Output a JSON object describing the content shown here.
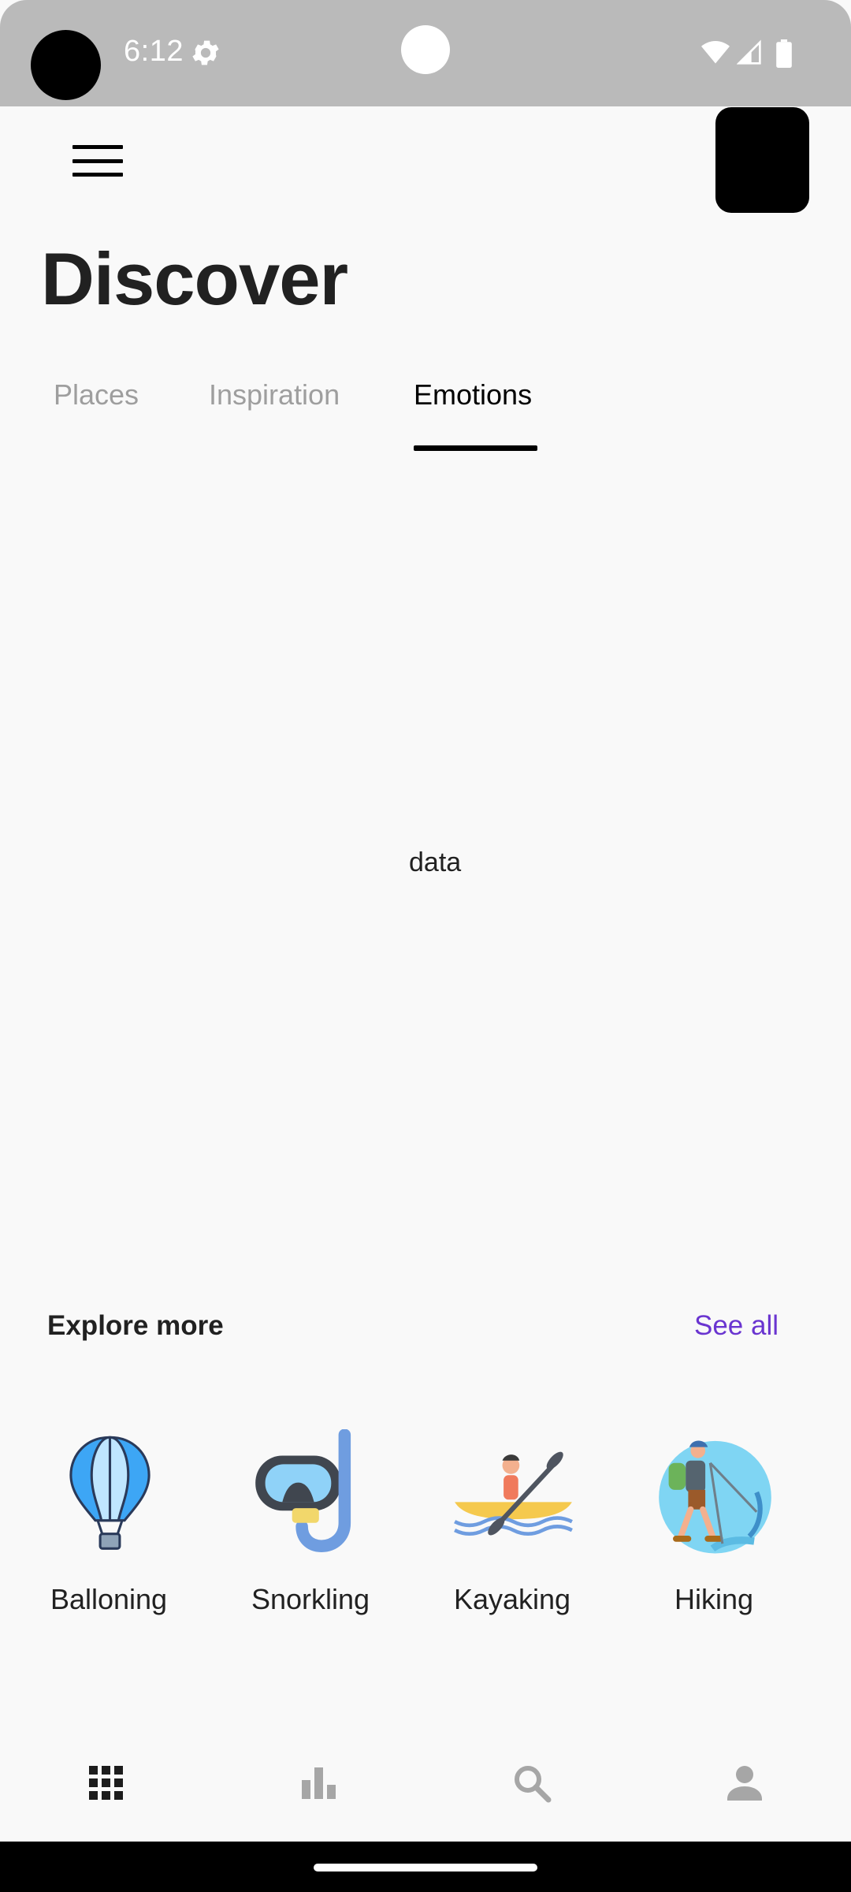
{
  "status_bar": {
    "time": "6:12",
    "icons": [
      "gear-icon",
      "wifi-icon",
      "cell-signal-icon",
      "battery-icon"
    ]
  },
  "app_bar": {
    "menu_icon": "hamburger-menu-icon",
    "avatar": "avatar"
  },
  "page": {
    "title": "Discover"
  },
  "tabs": [
    {
      "label": "Places",
      "active": false
    },
    {
      "label": "Inspiration",
      "active": false
    },
    {
      "label": "Emotions",
      "active": true
    }
  ],
  "content": {
    "placeholder_text": "data"
  },
  "explore": {
    "title": "Explore more",
    "see_all": "See all",
    "see_all_color": "#6a35d0",
    "items": [
      {
        "label": "Balloning",
        "icon": "hot-air-balloon-icon"
      },
      {
        "label": "Snorkling",
        "icon": "snorkel-mask-icon"
      },
      {
        "label": "Kayaking",
        "icon": "kayak-icon"
      },
      {
        "label": "Hiking",
        "icon": "hiker-icon"
      }
    ]
  },
  "bottom_nav": [
    {
      "icon": "grid-icon",
      "active": true
    },
    {
      "icon": "bar-chart-icon",
      "active": false
    },
    {
      "icon": "search-icon",
      "active": false
    },
    {
      "icon": "person-icon",
      "active": false
    }
  ],
  "colors": {
    "status_bar_bg": "#bababa",
    "background": "#f9f9f9",
    "accent": "#6a35d0",
    "inactive_tab": "#9e9e9e"
  }
}
